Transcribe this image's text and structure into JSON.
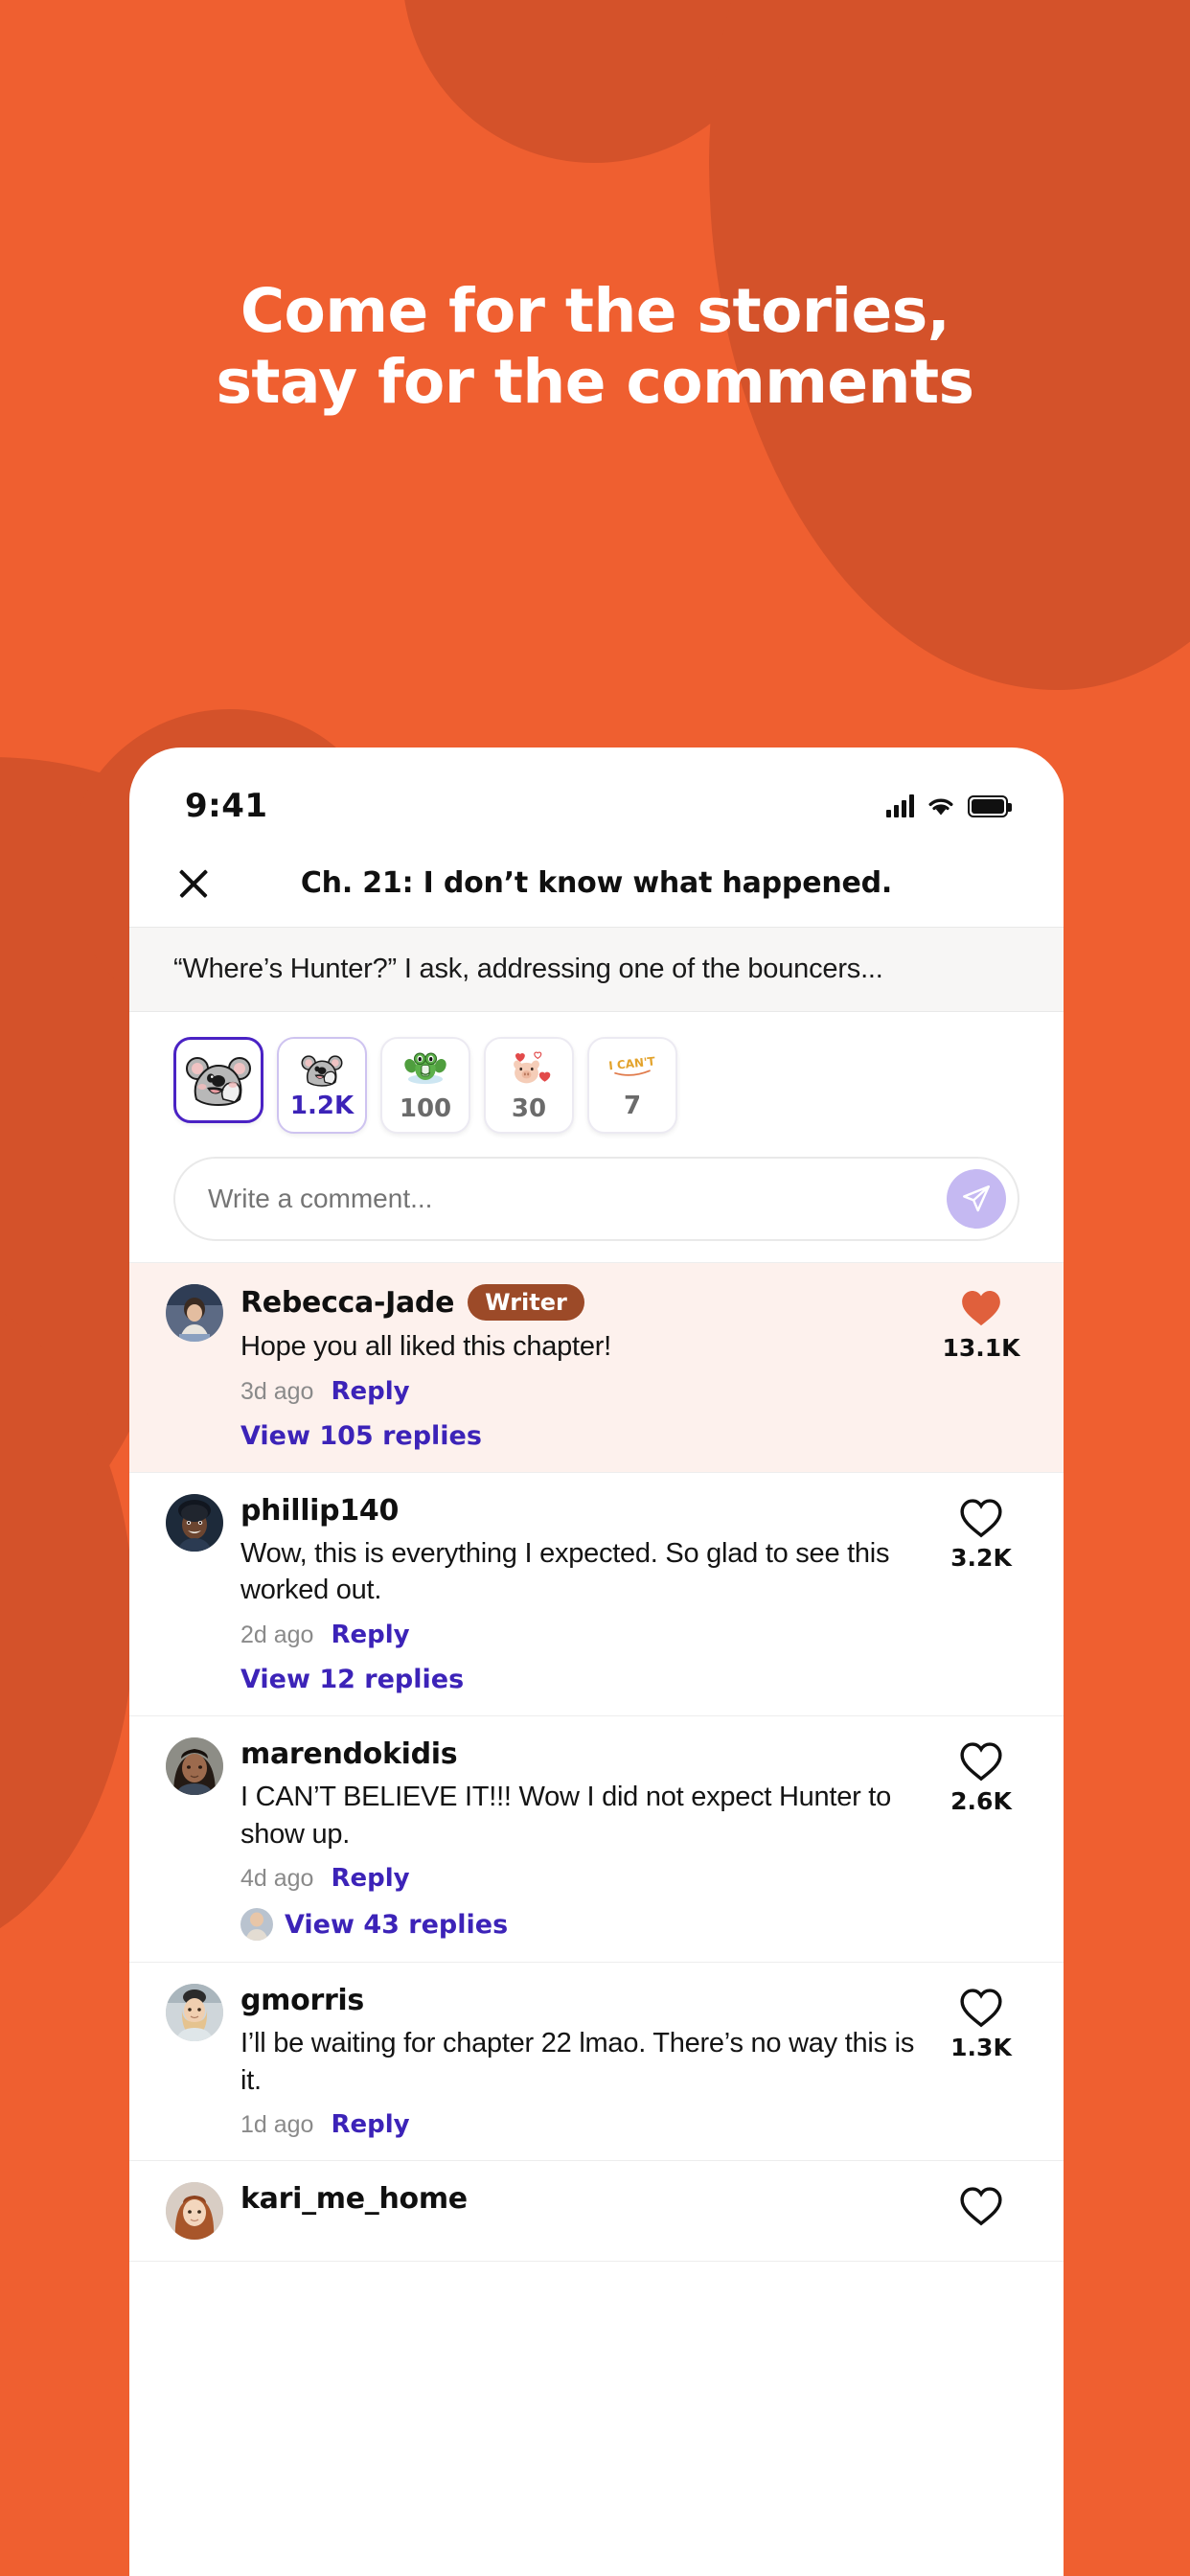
{
  "theme": {
    "bg_orange": "#ef5f30",
    "blob_orange": "#d4522a",
    "accent_purple": "#3c23b8",
    "heart_orange": "#e0603c",
    "writer_badge_brown": "#9c4a28",
    "highlight_pink": "#fdf1ed"
  },
  "headline": {
    "line1": "Come for the stories,",
    "line2": "stay for the comments"
  },
  "status_bar": {
    "time": "9:41",
    "signal_icon": "signal-bars-icon",
    "wifi_icon": "wifi-icon",
    "battery_icon": "battery-icon"
  },
  "chapter_header": {
    "close_icon": "close-icon",
    "title": "Ch. 21: I don’t know what happened."
  },
  "excerpt": {
    "text": "“Where’s Hunter?” I ask, addressing one of the bouncers..."
  },
  "reactions": [
    {
      "sticker": "koala-laughing-sticker",
      "count": "",
      "state": "selected"
    },
    {
      "sticker": "koala-laughing-sticker",
      "count": "1.2K",
      "state": "accent"
    },
    {
      "sticker": "frog-splash-sticker",
      "count": "100",
      "state": "normal"
    },
    {
      "sticker": "pig-hearts-sticker",
      "count": "30",
      "state": "normal"
    },
    {
      "sticker": "i-cant-text-sticker",
      "count": "7",
      "state": "normal"
    }
  ],
  "composer": {
    "placeholder": "Write a comment...",
    "value": "",
    "send_icon": "send-paper-plane-icon"
  },
  "comments": [
    {
      "username": "Rebecca-Jade",
      "badge": "Writer",
      "text": "Hope you all liked this chapter!",
      "time_ago": "3d ago",
      "reply_label": "Reply",
      "view_replies": "View 105 replies",
      "replies_avatar": false,
      "like_count": "13.1K",
      "liked": true,
      "highlight": true,
      "avatar": "avatar-rebecca-jade"
    },
    {
      "username": "phillip140",
      "badge": "",
      "text": "Wow, this is everything I expected. So glad to see this worked out.",
      "time_ago": "2d ago",
      "reply_label": "Reply",
      "view_replies": "View 12 replies",
      "replies_avatar": false,
      "like_count": "3.2K",
      "liked": false,
      "highlight": false,
      "avatar": "avatar-phillip140"
    },
    {
      "username": "marendokidis",
      "badge": "",
      "text": "I CAN’T BELIEVE IT!!! Wow I did not expect Hunter to show up.",
      "time_ago": "4d ago",
      "reply_label": "Reply",
      "view_replies": "View 43 replies",
      "replies_avatar": true,
      "like_count": "2.6K",
      "liked": false,
      "highlight": false,
      "avatar": "avatar-marendokidis"
    },
    {
      "username": "gmorris",
      "badge": "",
      "text": "I’ll be waiting for chapter 22 lmao. There’s no way this is it.",
      "time_ago": "1d ago",
      "reply_label": "Reply",
      "view_replies": "",
      "replies_avatar": false,
      "like_count": "1.3K",
      "liked": false,
      "highlight": false,
      "avatar": "avatar-gmorris"
    },
    {
      "username": "kari_me_home",
      "badge": "",
      "text": "",
      "time_ago": "",
      "reply_label": "",
      "view_replies": "",
      "replies_avatar": false,
      "like_count": "",
      "liked": false,
      "highlight": false,
      "avatar": "avatar-kari-me-home"
    }
  ]
}
